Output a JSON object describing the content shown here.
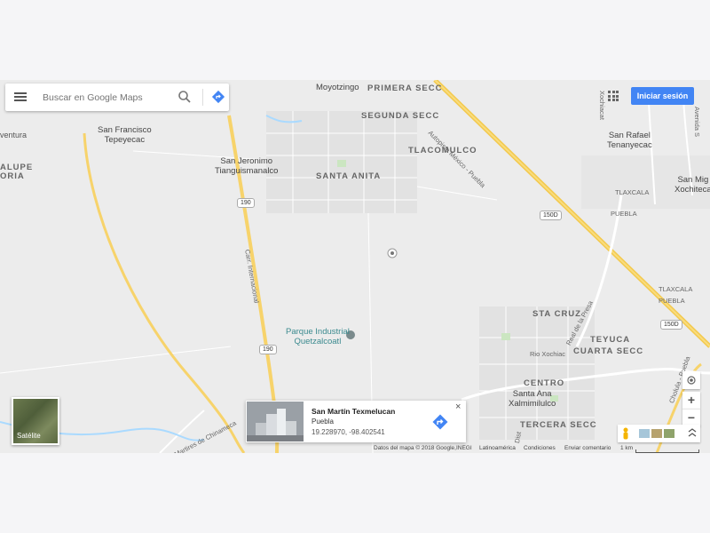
{
  "search": {
    "placeholder": "Buscar en Google Maps"
  },
  "header": {
    "signin_label": "Iniciar sesión"
  },
  "map": {
    "towns": [
      "PRIMERA SECC",
      "SEGUNDA SECC",
      "TLACOMULCO",
      "SANTA ANITA",
      "STA CRUZ",
      "TEYUCA",
      "CUARTA SECC",
      "CENTRO",
      "TERCERA SECC",
      "ALUPE",
      "ORIA"
    ],
    "places": {
      "moyotzingo": "Moyotzingo",
      "san_francisco": [
        "San Francisco",
        "Tepeyecac"
      ],
      "san_jeronimo": [
        "San Jeronimo",
        "Tianguismanalco"
      ],
      "san_rafael": [
        "San Rafael",
        "Tenanyecac"
      ],
      "san_mig": [
        "San Mig",
        "Xochiteca"
      ],
      "santa_ana": [
        "Santa Ana",
        "Xalmimilulco"
      ],
      "ventura": "ventura"
    },
    "poi": [
      "Parque Industrial",
      "Quetzalcoatl"
    ],
    "road_labels": {
      "autopista": "Autopista México - Puebla",
      "carr_internacional": "Carr. Internacional",
      "tlaxcala1": "TLAXCALA",
      "puebla1": "PUEBLA",
      "tlaxcala2": "TLAXCALA",
      "puebla2": "PUEBLA",
      "real_de_la_presa": "Real de la Presa",
      "rio_xochiac": "Rio Xochiac",
      "martires": "Martires de Chinameca",
      "cholula": "Cholula - Puebla",
      "xochiacat": "Xochiacat",
      "avenida": "Avenida S",
      "dist": "Dist"
    },
    "shields": [
      "190",
      "190",
      "150D",
      "150D"
    ]
  },
  "satellite": {
    "label": "Satélite"
  },
  "place_card": {
    "title": "San Martín Texmelucan",
    "subtitle": "Puebla",
    "coords": "19.228970, -98.402541",
    "close": "×"
  },
  "controls": {
    "zoom_in": "+",
    "zoom_out": "−"
  },
  "footer": {
    "attribution": "Datos del mapa © 2018 Google,INEGI",
    "region": "Latinoamérica",
    "terms": "Condiciones",
    "feedback": "Enviar comentario",
    "scale": "1 km"
  }
}
